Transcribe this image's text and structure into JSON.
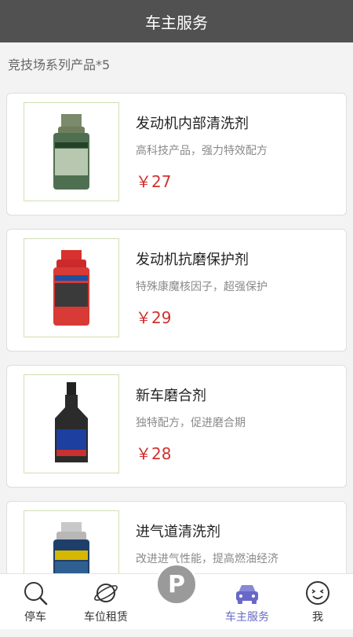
{
  "header": {
    "title": "车主服务"
  },
  "section": {
    "title": "竞技场系列产品*5"
  },
  "products": [
    {
      "name": "发动机内部清洗剂",
      "desc": "高科技产品，强力特效配方",
      "price": "￥27",
      "image": "green-can-product"
    },
    {
      "name": "发动机抗磨保护剂",
      "desc": "特殊康魔核因子，超强保护",
      "price": "￥29",
      "image": "red-can-product"
    },
    {
      "name": "新车磨合剂",
      "desc": "独特配方，促进磨合期",
      "price": "￥28",
      "image": "black-bottle-product"
    },
    {
      "name": "进气道清洗剂",
      "desc": "改进进气性能，提高燃油经济",
      "price": "",
      "image": "blue-can-product"
    }
  ],
  "tabbar": {
    "items": [
      {
        "label": "停车",
        "icon": "search-icon"
      },
      {
        "label": "车位租赁",
        "icon": "planet-icon"
      },
      {
        "label": "车主服务",
        "icon": "car-icon",
        "active": true
      },
      {
        "label": "我",
        "icon": "face-icon"
      }
    ],
    "center": {
      "label": "P",
      "icon": "parking-icon"
    }
  },
  "colors": {
    "header_bg": "#515151",
    "price": "#d0312f",
    "active_tab": "#6868c8"
  }
}
